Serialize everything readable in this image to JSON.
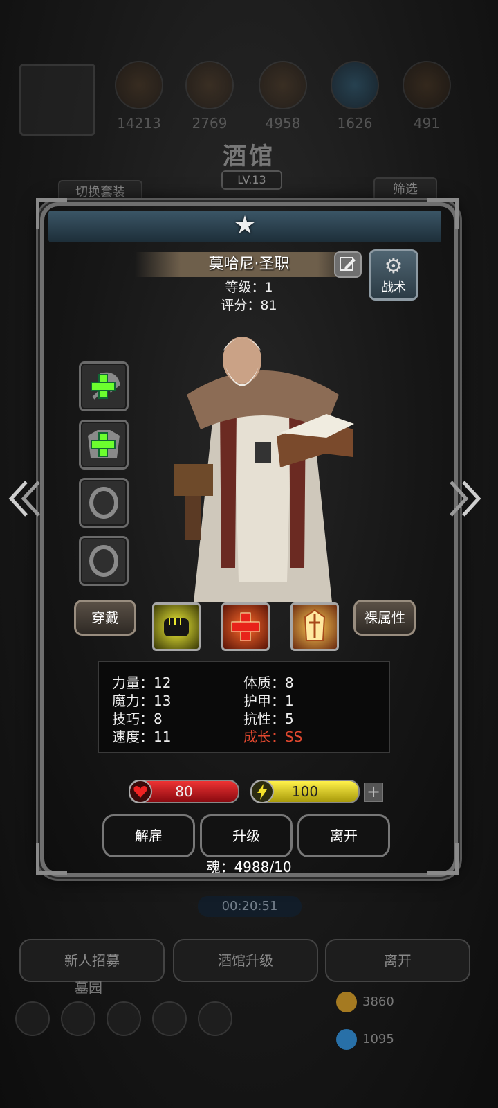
{
  "background": {
    "resources": [
      "14213",
      "2769",
      "4958",
      "1626",
      "491"
    ],
    "title": "酒馆",
    "level": "LV.13",
    "switch_outfit": "切换套装",
    "filter": "筛选",
    "timer": "00:20:51",
    "bottom_buttons": [
      "新人招募",
      "酒馆升级",
      "离开"
    ],
    "cemetery": "墓园",
    "currency_gold": "3860",
    "currency_blue": "1095"
  },
  "hero": {
    "name": "莫哈尼·圣职",
    "level_line": "等级：1",
    "score_line": "评分：81",
    "tactics": "战术"
  },
  "actions": {
    "equip": "穿戴",
    "bare_stats": "裸属性"
  },
  "stats": {
    "strength": "力量：12",
    "constitution": "体质：8",
    "magic": "魔力：13",
    "armor": "护甲：1",
    "skill": "技巧：8",
    "resistance": "抗性：5",
    "speed": "速度：11",
    "growth": "成长：SS"
  },
  "bars": {
    "hp": "80",
    "energy": "100"
  },
  "buttons": {
    "dismiss": "解雇",
    "upgrade": "升级",
    "leave": "离开"
  },
  "soul": "魂：4988/10",
  "colors": {
    "hp_bar": "#c4111b",
    "energy_bar": "#e3d418",
    "growth_text": "#e0482f",
    "add_slot": "#6cff2e"
  },
  "icons": [
    "star-icon",
    "edit-icon",
    "gear-icon",
    "plus-icon",
    "ring-icon",
    "fist-icon",
    "cross-icon",
    "armor-icon",
    "heart-icon",
    "lightning-icon",
    "arrow-left-icon",
    "arrow-right-icon"
  ]
}
